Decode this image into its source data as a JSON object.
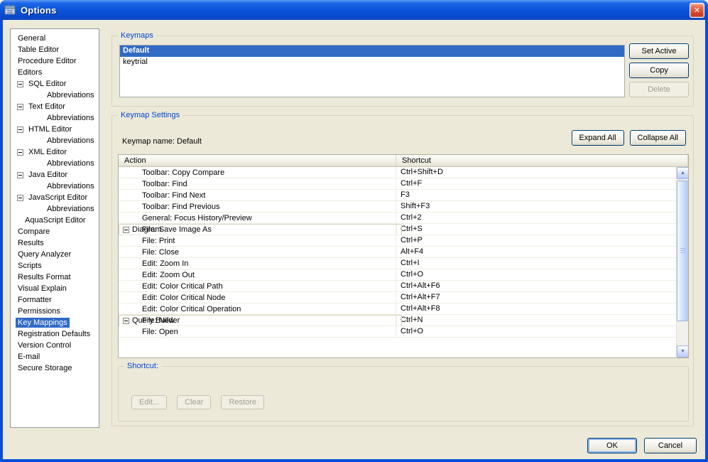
{
  "window": {
    "title": "Options"
  },
  "colors": {
    "selection": "#316AC5",
    "legend": "#0046D5",
    "titlebar": "#0B54DC",
    "close_red": "#D54526"
  },
  "icons": {
    "close": "✕",
    "scroll_up": "▲",
    "scroll_down": "▼",
    "app": "options-cabinet",
    "tree_collapse": "minus-box"
  },
  "sidebar": {
    "items": [
      {
        "label": "General",
        "level": 0
      },
      {
        "label": "Table Editor",
        "level": 0
      },
      {
        "label": "Procedure Editor",
        "level": 0
      },
      {
        "label": "Editors",
        "level": 0
      },
      {
        "label": "SQL Editor",
        "level": 1,
        "expander": true
      },
      {
        "label": "Abbreviations",
        "level": 2
      },
      {
        "label": "Text Editor",
        "level": 1,
        "expander": true
      },
      {
        "label": "Abbreviations",
        "level": 2
      },
      {
        "label": "HTML Editor",
        "level": 1,
        "expander": true
      },
      {
        "label": "Abbreviations",
        "level": 2
      },
      {
        "label": "XML Editor",
        "level": 1,
        "expander": true
      },
      {
        "label": "Abbreviations",
        "level": 2
      },
      {
        "label": "Java Editor",
        "level": 1,
        "expander": true
      },
      {
        "label": "Abbreviations",
        "level": 2
      },
      {
        "label": "JavaScript Editor",
        "level": 1,
        "expander": true
      },
      {
        "label": "Abbreviations",
        "level": 2
      },
      {
        "label": "AquaScript Editor",
        "level": 1
      },
      {
        "label": "Compare",
        "level": 0
      },
      {
        "label": "Results",
        "level": 0
      },
      {
        "label": "Query Analyzer",
        "level": 0
      },
      {
        "label": "Scripts",
        "level": 0
      },
      {
        "label": "Results Format",
        "level": 0
      },
      {
        "label": "Visual Explain",
        "level": 0
      },
      {
        "label": "Formatter",
        "level": 0
      },
      {
        "label": "Permissions",
        "level": 0
      },
      {
        "label": "Key Mappings",
        "level": 0,
        "selected": true
      },
      {
        "label": "Registration Defaults",
        "level": 0
      },
      {
        "label": "Version Control",
        "level": 0
      },
      {
        "label": "E-mail",
        "level": 0
      },
      {
        "label": "Secure Storage",
        "level": 0
      }
    ]
  },
  "keymaps": {
    "legend": "Keymaps",
    "items": [
      {
        "label": "Default",
        "selected": true
      },
      {
        "label": "keytrial",
        "selected": false
      }
    ],
    "buttons": {
      "set_active": "Set Active",
      "copy": "Copy",
      "delete": "Delete"
    }
  },
  "settings": {
    "legend": "Keymap Settings",
    "keymap_name_label": "Keymap name: Default",
    "buttons": {
      "expand_all": "Expand All",
      "collapse_all": "Collapse All"
    },
    "table": {
      "columns": [
        "Action",
        "Shortcut"
      ],
      "rows": [
        {
          "type": "item",
          "action": "Toolbar: Copy Compare",
          "shortcut": "Ctrl+Shift+D"
        },
        {
          "type": "item",
          "action": "Toolbar: Find",
          "shortcut": "Ctrl+F"
        },
        {
          "type": "item",
          "action": "Toolbar: Find Next",
          "shortcut": "F3"
        },
        {
          "type": "item",
          "action": "Toolbar: Find Previous",
          "shortcut": "Shift+F3"
        },
        {
          "type": "item",
          "action": "General: Focus History/Preview",
          "shortcut": "Ctrl+2"
        },
        {
          "type": "group",
          "action": "Diagram",
          "shortcut": ""
        },
        {
          "type": "item",
          "action": "File: Save Image As",
          "shortcut": "Ctrl+S"
        },
        {
          "type": "item",
          "action": "File: Print",
          "shortcut": "Ctrl+P"
        },
        {
          "type": "item",
          "action": "File: Close",
          "shortcut": "Alt+F4"
        },
        {
          "type": "item",
          "action": "Edit: Zoom In",
          "shortcut": "Ctrl+I"
        },
        {
          "type": "item",
          "action": "Edit: Zoom Out",
          "shortcut": "Ctrl+O"
        },
        {
          "type": "item",
          "action": "Edit: Color Critical Path",
          "shortcut": "Ctrl+Alt+F6"
        },
        {
          "type": "item",
          "action": "Edit: Color Critical Node",
          "shortcut": "Ctrl+Alt+F7"
        },
        {
          "type": "item",
          "action": "Edit: Color Critical Operation",
          "shortcut": "Ctrl+Alt+F8"
        },
        {
          "type": "group",
          "action": "Query Builder",
          "shortcut": ""
        },
        {
          "type": "item",
          "action": "File: New",
          "shortcut": "Ctrl+N"
        },
        {
          "type": "item",
          "action": "File: Open",
          "shortcut": "Ctrl+O"
        }
      ]
    },
    "shortcut_group": {
      "legend": "Shortcut:",
      "buttons": {
        "edit": "Edit...",
        "clear": "Clear",
        "restore": "Restore"
      }
    }
  },
  "footer": {
    "ok": "OK",
    "cancel": "Cancel"
  }
}
